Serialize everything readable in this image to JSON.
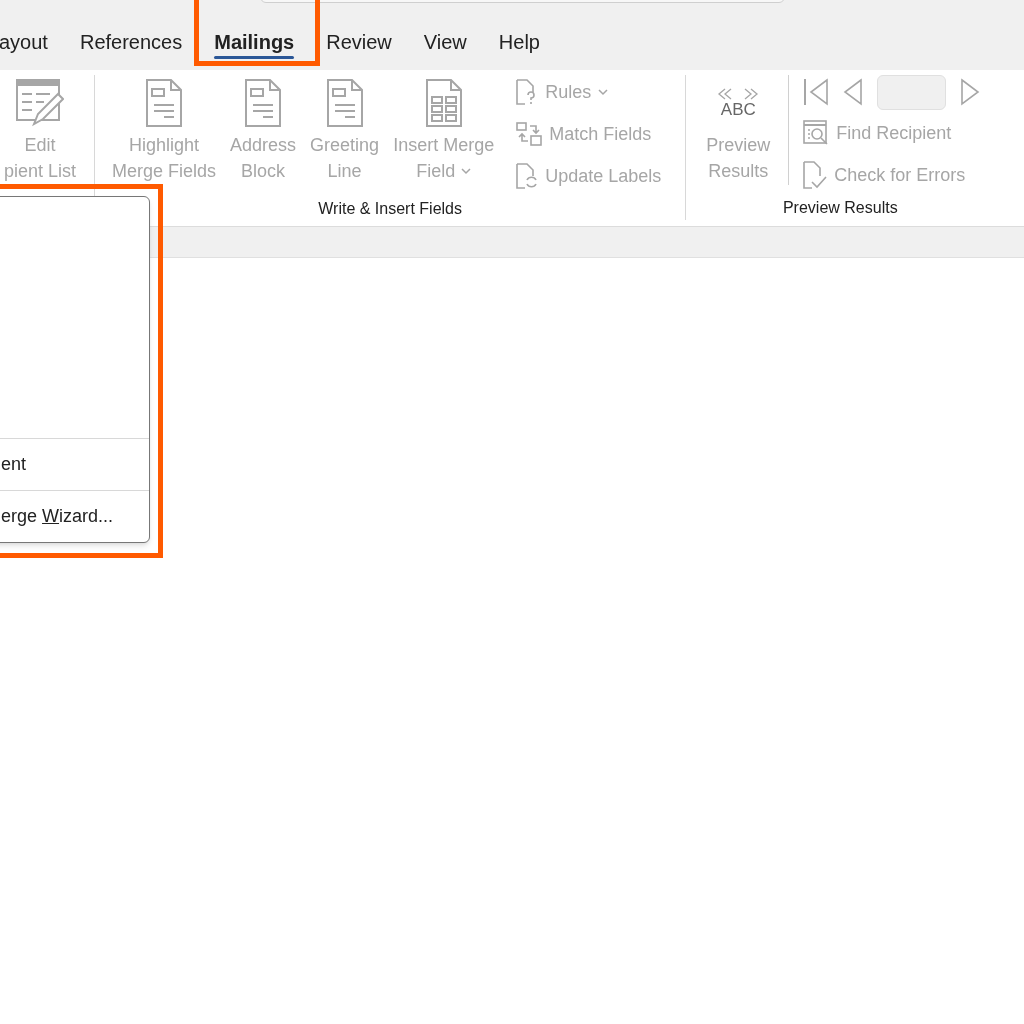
{
  "tabs": [
    {
      "label": "ayout",
      "selected": false,
      "highlighted": false
    },
    {
      "label": "References",
      "selected": false,
      "highlighted": false
    },
    {
      "label": "Mailings",
      "selected": true,
      "highlighted": true
    },
    {
      "label": "Review",
      "selected": false,
      "highlighted": false
    },
    {
      "label": "View",
      "selected": false,
      "highlighted": false
    },
    {
      "label": "Help",
      "selected": false,
      "highlighted": false
    }
  ],
  "ribbon": {
    "groups": [
      {
        "commands": [
          {
            "kind": "large",
            "lines": [
              "Edit",
              "pient List"
            ],
            "disabled": true,
            "dropdown": false
          }
        ]
      },
      {
        "label": "Write & Insert Fields",
        "commands": [
          {
            "kind": "large",
            "lines": [
              "Highlight",
              "Merge Fields"
            ],
            "disabled": true,
            "dropdown": false
          },
          {
            "kind": "large",
            "lines": [
              "Address",
              "Block"
            ],
            "disabled": true,
            "dropdown": false
          },
          {
            "kind": "large",
            "lines": [
              "Greeting",
              "Line"
            ],
            "disabled": true,
            "dropdown": false
          },
          {
            "kind": "large",
            "lines": [
              "Insert Merge",
              "Field"
            ],
            "disabled": true,
            "dropdown": true
          },
          {
            "kind": "stack",
            "items": [
              {
                "label": "Rules",
                "disabled": true,
                "dropdown": true
              },
              {
                "label": "Match Fields",
                "disabled": true,
                "dropdown": false
              },
              {
                "label": "Update Labels",
                "disabled": true,
                "dropdown": false
              }
            ]
          }
        ]
      },
      {
        "label": "Preview Results",
        "commands": [
          {
            "kind": "large",
            "icon_text": "ABC",
            "lines": [
              "Preview",
              "Results"
            ],
            "disabled": true,
            "dropdown": false
          },
          {
            "kind": "nav",
            "items": [
              {
                "kind": "first",
                "disabled": true
              },
              {
                "kind": "prev",
                "disabled": true
              },
              {
                "kind": "field",
                "disabled": true
              },
              {
                "kind": "next",
                "disabled": true
              }
            ],
            "rows": [
              {
                "label": "Find Recipient",
                "disabled": true
              },
              {
                "label": "Check for Errors",
                "disabled": true
              }
            ]
          }
        ]
      }
    ]
  },
  "menu": {
    "highlighted": true,
    "items": [
      {
        "label": "ent"
      },
      {
        "label_before": "erge ",
        "access_key": "W",
        "label_after": "izard..."
      }
    ]
  }
}
